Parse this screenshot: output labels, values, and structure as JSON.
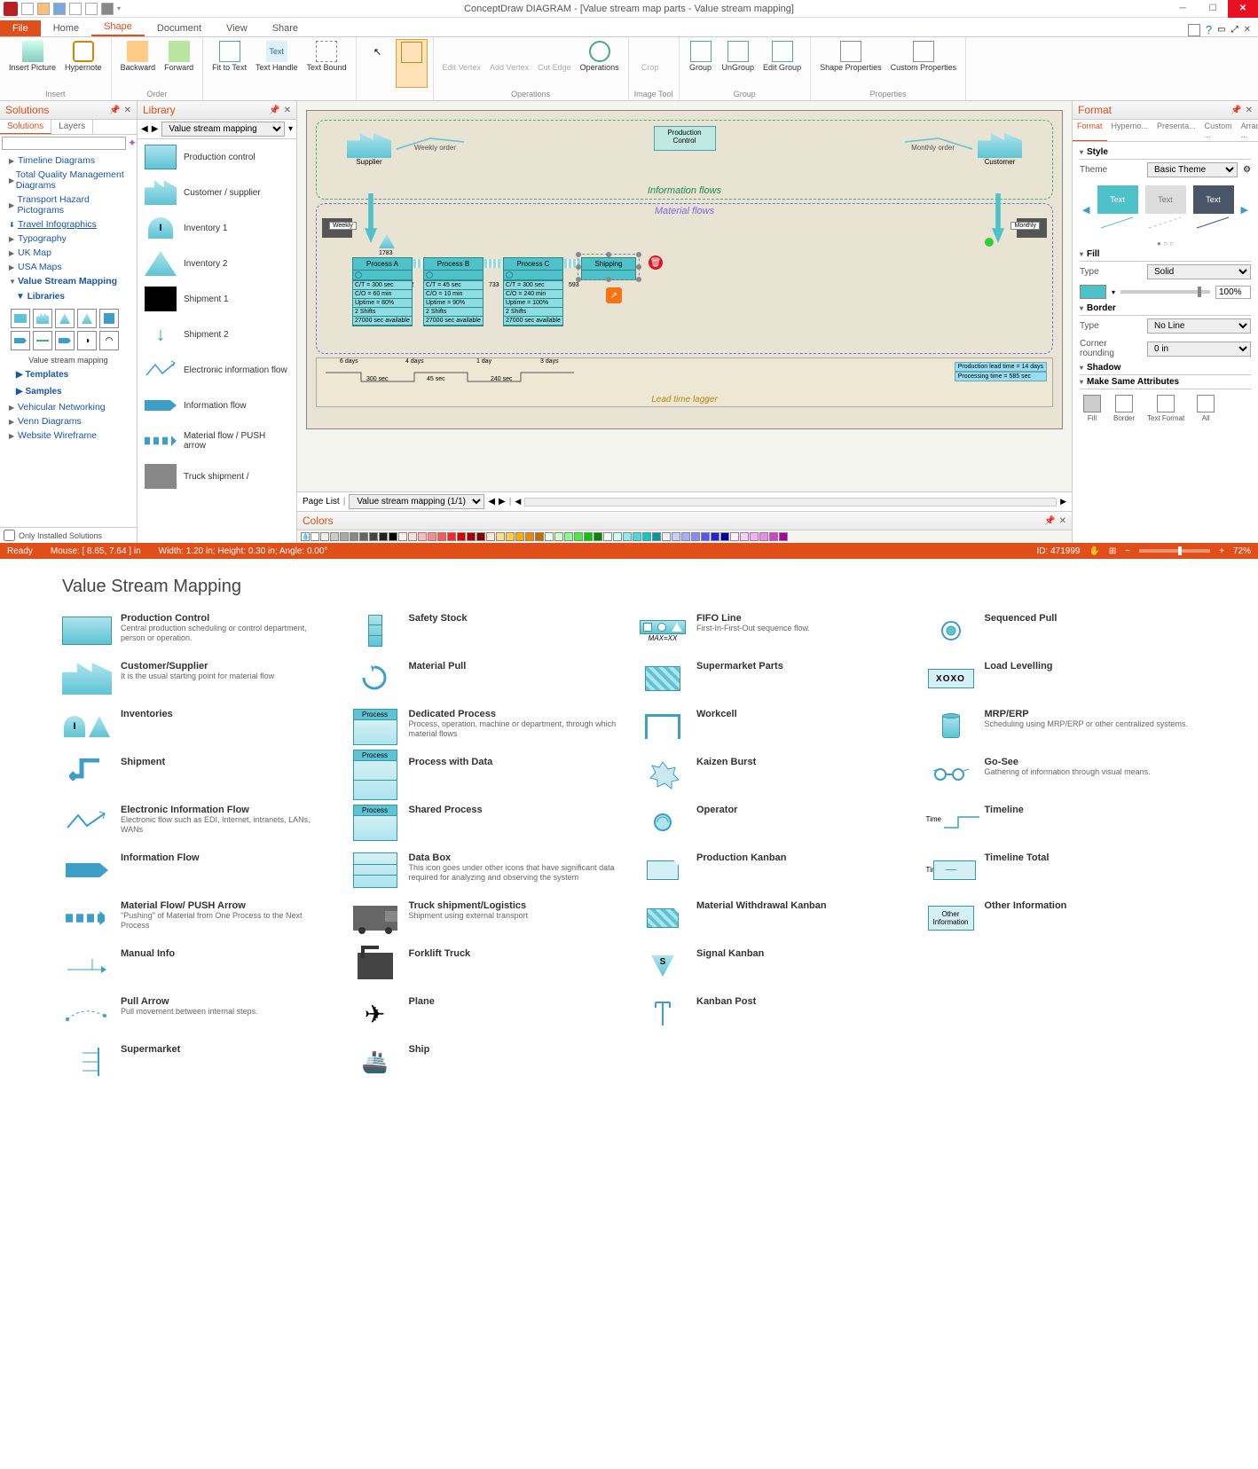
{
  "titlebar": {
    "title": "ConceptDraw DIAGRAM - [Value stream map parts - Value stream mapping]"
  },
  "menu": {
    "tabs": [
      "File",
      "Home",
      "Shape",
      "Document",
      "View",
      "Share"
    ]
  },
  "ribbon": {
    "groups": {
      "insert": {
        "label": "Insert",
        "insert_picture": "Insert Picture",
        "hypernote": "Hypernote"
      },
      "order": {
        "label": "Order",
        "backward": "Backward",
        "forward": "Forward"
      },
      "text": {
        "fit": "Fit to Text",
        "handle": "Text Handle",
        "bound": "Text Bound"
      },
      "point": "Point",
      "run": "Run Around Objects",
      "operations": {
        "label": "Operations",
        "edit_vertex": "Edit Vertex",
        "add_vertex": "Add Vertex",
        "cut_edge": "Cut Edge",
        "ops": "Operations"
      },
      "image": {
        "label": "Image Tool",
        "crop": "Crop"
      },
      "group": {
        "label": "Group",
        "group": "Group",
        "ungroup": "UnGroup",
        "edit_group": "Edit Group"
      },
      "properties": {
        "label": "Properties",
        "shape": "Shape Properties",
        "custom": "Custom Properties"
      }
    }
  },
  "solutions": {
    "title": "Solutions",
    "tabs": [
      "Solutions",
      "Layers"
    ],
    "items": [
      "Timeline Diagrams",
      "Total Quality Management Diagrams",
      "Transport Hazard Pictograms",
      "Travel Infographics",
      "Typography",
      "UK Map",
      "USA Maps",
      "Value Stream Mapping"
    ],
    "libraries_label": "Libraries",
    "palette_label": "Value stream mapping",
    "templates": "Templates",
    "samples": "Samples",
    "more": [
      "Vehicular Networking",
      "Venn Diagrams",
      "Website Wireframe"
    ],
    "only_installed": "Only Installed Solutions"
  },
  "library": {
    "title": "Library",
    "selected": "Value stream mapping",
    "items": [
      {
        "label": "Production control"
      },
      {
        "label": "Customer / supplier"
      },
      {
        "label": "Inventory 1"
      },
      {
        "label": "Inventory 2"
      },
      {
        "label": "Shipment 1"
      },
      {
        "label": "Shipment 2"
      },
      {
        "label": "Electronic information flow"
      },
      {
        "label": "Information flow"
      },
      {
        "label": "Material flow / PUSH arrow"
      },
      {
        "label": "Truck shipment /"
      }
    ]
  },
  "canvas": {
    "info_flows": "Information flows",
    "pc": "Production Control",
    "supplier": "Supplier",
    "customer": "Customer",
    "weekly_order": "Weekly order",
    "monthly_order": "Monthly order",
    "material_flows": "Material flows",
    "weekly": "Weekly",
    "monthly": "Monthly",
    "inv1783": "1783",
    "proc_a": "Process A",
    "proc_b": "Process B",
    "proc_c": "Process C",
    "shipping": "Shipping",
    "inv1202": "1202",
    "inv733": "733",
    "inv593": "593",
    "data_rows_a": [
      "C/T = 300 sec",
      "C/O = 60 min",
      "Uptime = 80%",
      "2 Shifts",
      "27000 sec available"
    ],
    "data_rows_b": [
      "C/T = 45 sec",
      "C/O = 10 min",
      "Uptime = 90%",
      "2 Shifts",
      "27000 sec available"
    ],
    "data_rows_c": [
      "C/T = 300 sec",
      "C/O = 240 min",
      "Uptime = 100%",
      "2 Shifts",
      "27000 sec available"
    ],
    "leadtime": "Lead time lagger",
    "days": [
      "6 days",
      "4 days",
      "1 day",
      "3 days"
    ],
    "secs": [
      "300 sec",
      "45 sec",
      "240 sec"
    ],
    "prod_lead": "Production lead time = 14 days",
    "proc_time": "Processing time = 585 sec",
    "page_list": "Page List",
    "page_combo": "Value stream mapping (1/1)",
    "colors_title": "Colors"
  },
  "format": {
    "title": "Format",
    "tabs": [
      "Format",
      "Hyperno...",
      "Presenta...",
      "Custom ...",
      "Arrange ..."
    ],
    "style": "Style",
    "theme": "Theme",
    "theme_val": "Basic Theme",
    "text": "Text",
    "fill": "Fill",
    "type": "Type",
    "fill_type": "Solid",
    "fill_pct": "100%",
    "border": "Border",
    "border_type": "No Line",
    "corner": "Corner rounding",
    "corner_val": "0 in",
    "shadow": "Shadow",
    "same_attr": "Make Same Attributes",
    "icons": [
      "Fill",
      "Border",
      "Text Format",
      "All"
    ]
  },
  "status": {
    "ready": "Ready",
    "mouse": "Mouse: [ 8.65, 7.64 ] in",
    "size": "Width: 1.20 in;   Height: 0.30 in;   Angle: 0.00°",
    "id": "ID: 471999",
    "zoom": "72%"
  },
  "legend": {
    "title": "Value Stream Mapping",
    "items": [
      {
        "name": "Production Control",
        "desc": "Central production scheduling or control department, person or operation."
      },
      {
        "name": "Customer/Supplier",
        "desc": "It is the usual starting point for material flow"
      },
      {
        "name": "Inventories",
        "desc": ""
      },
      {
        "name": "Shipment",
        "desc": ""
      },
      {
        "name": "Electronic Information Flow",
        "desc": "Electronic flow such as EDI, Internet, intranets, LANs, WANs"
      },
      {
        "name": "Information Flow",
        "desc": ""
      },
      {
        "name": "Material Flow/ PUSH Arrow",
        "desc": "\"Pushing\" of Material from One Process to the Next Process"
      },
      {
        "name": "Manual Info",
        "desc": ""
      },
      {
        "name": "Pull Arrow",
        "desc": "Pull movement between internal steps."
      },
      {
        "name": "Supermarket",
        "desc": ""
      },
      {
        "name": "Safety Stock",
        "desc": ""
      },
      {
        "name": "Material Pull",
        "desc": ""
      },
      {
        "name": "Dedicated Process",
        "desc": "Process, operation, machine or department, through which material flows"
      },
      {
        "name": "Process with Data",
        "desc": ""
      },
      {
        "name": "Shared Process",
        "desc": ""
      },
      {
        "name": "Data Box",
        "desc": "This icon goes under other icons that have significant data required for analyzing and observing the system"
      },
      {
        "name": "Truck shipment/Logistics",
        "desc": "Shipment using external transport"
      },
      {
        "name": "Forklift Truck",
        "desc": ""
      },
      {
        "name": "Plane",
        "desc": ""
      },
      {
        "name": "Ship",
        "desc": ""
      },
      {
        "name": "FIFO Line",
        "desc": "First-In-First-Out sequence flow.",
        "extra": "MAX=XX"
      },
      {
        "name": "Supermarket Parts",
        "desc": ""
      },
      {
        "name": "Workcell",
        "desc": ""
      },
      {
        "name": "Kaizen Burst",
        "desc": ""
      },
      {
        "name": "Operator",
        "desc": ""
      },
      {
        "name": "Production Kanban",
        "desc": ""
      },
      {
        "name": "Material Withdrawal Kanban",
        "desc": ""
      },
      {
        "name": "Signal Kanban",
        "desc": ""
      },
      {
        "name": "Kanban Post",
        "desc": ""
      },
      {
        "name": "Sequenced Pull",
        "desc": ""
      },
      {
        "name": "Load Levelling",
        "desc": ""
      },
      {
        "name": "MRP/ERP",
        "desc": "Scheduling using MRP/ERP or other centralized systems."
      },
      {
        "name": "Go-See",
        "desc": "Gathering of information through visual means."
      },
      {
        "name": "Timeline",
        "desc": ""
      },
      {
        "name": "Timeline Total",
        "desc": ""
      },
      {
        "name": "Other Information",
        "desc": ""
      }
    ],
    "process_label": "Process",
    "time_label": "Time",
    "other_info": "Other Information",
    "xoxo": "XOXO",
    "signal_s": "S"
  }
}
